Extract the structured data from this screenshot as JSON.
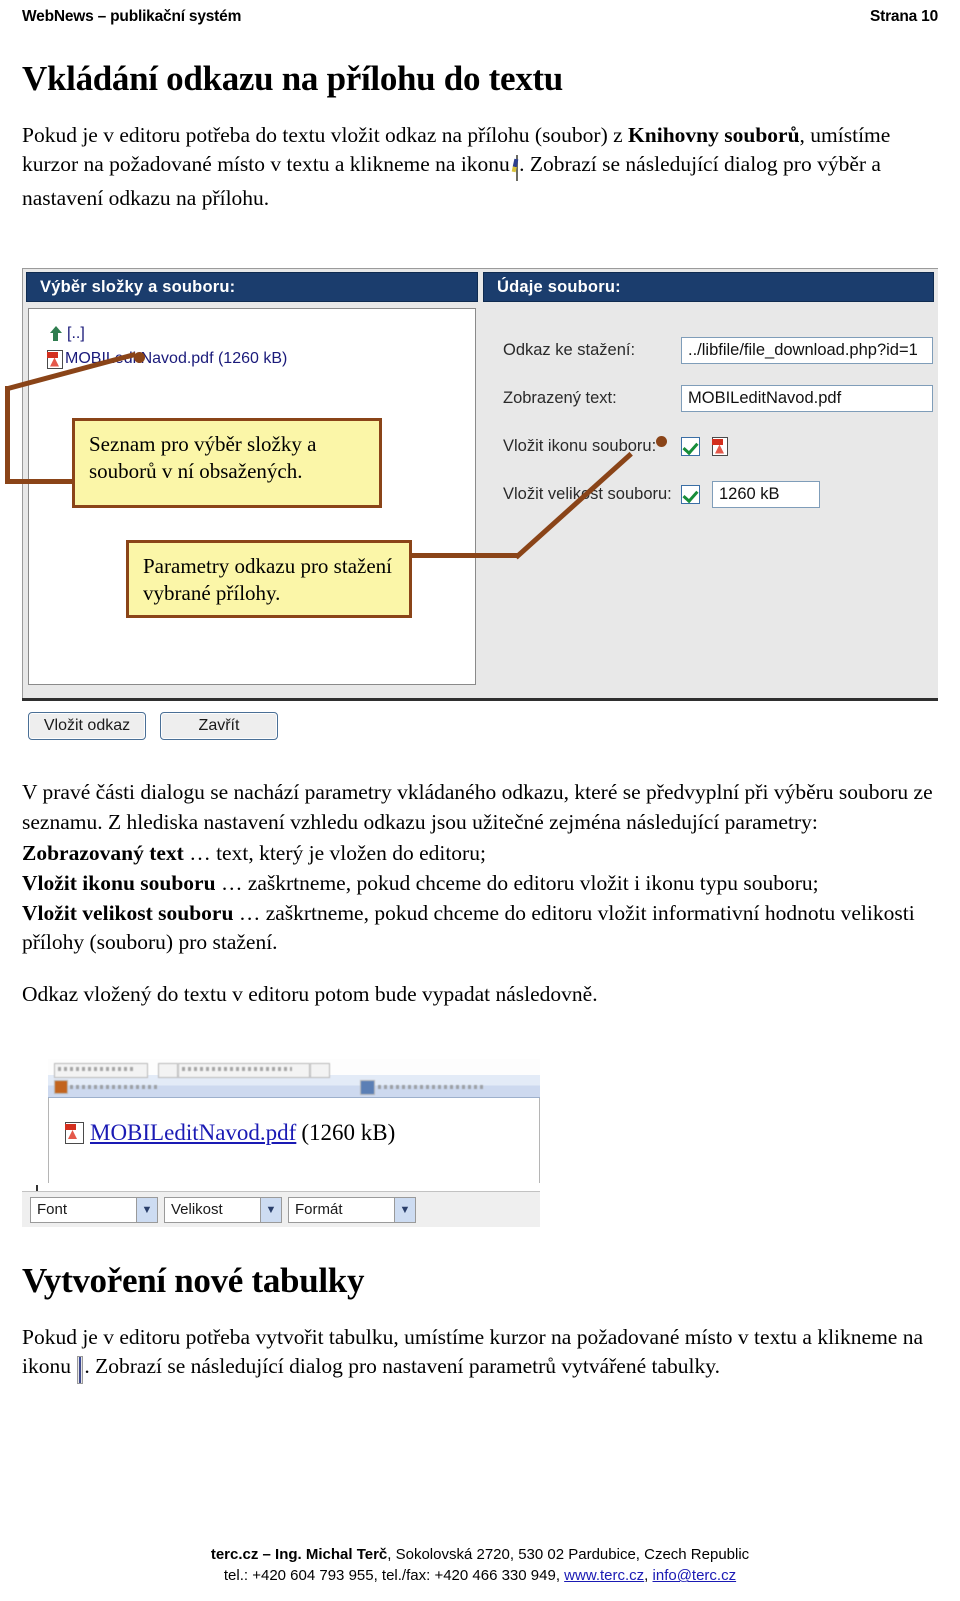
{
  "header": {
    "left": "WebNews – publikační systém",
    "right": "Strana 10"
  },
  "section1": {
    "title": "Vkládání odkazu na přílohu do textu",
    "intro_1": "Pokud je v editoru potřeba do textu vložit odkaz na přílohu (soubor) z ",
    "intro_bold": "Knihovny souborů",
    "intro_2": ", umístíme kurzor na požadované místo v textu a klikneme na ikonu ",
    "intro_3": ". Zobrazí se následující dialog pro výběr a nastavení odkazu na přílohu.",
    "attach_icon": "attachment-library-icon"
  },
  "dialog": {
    "left_panel": {
      "title": "Výběr složky a souboru:",
      "items": [
        {
          "icon": "folder-up-icon",
          "label": "[..]"
        },
        {
          "icon": "pdf-file-icon",
          "label": "MOBILeditNavod.pdf (1260 kB)"
        }
      ]
    },
    "right_panel": {
      "title": "Údaje souboru:",
      "fields": [
        {
          "label": "Odkaz ke stažení:",
          "value": "../libfile/file_download.php?id=1"
        },
        {
          "label": "Zobrazený text:",
          "value": "MOBILeditNavod.pdf"
        }
      ],
      "insert_icon": {
        "label": "Vložit ikonu souboru:",
        "checked": true,
        "icon": "pdf-file-icon"
      },
      "insert_size": {
        "label": "Vložit velikost souboru:",
        "checked": true,
        "value": "1260 kB"
      }
    },
    "buttons": {
      "insert": "Vložit odkaz",
      "close": "Zavřít"
    },
    "header_bg": "#1b3d6d"
  },
  "callouts": {
    "list": "Seznam pro výběr složky a souborů v ní obsažených.",
    "params": "Parametry odkazu pro stažení vybrané přílohy.",
    "color_fill": "#fbf6a8",
    "color_border": "#8a4418"
  },
  "section1_body": {
    "p1": "V pravé části dialogu se nachází parametry vkládaného odkazu, které se předvyplní při výběru souboru ze seznamu. Z hlediska nastavení vzhledu odkazu jsou užitečné zejména následující parametry:",
    "items": [
      {
        "term": "Zobrazovaný text",
        "desc": " … text, který je vložen do editoru;"
      },
      {
        "term": "Vložit ikonu souboru",
        "desc": " … zaškrtneme, pokud chceme do editoru vložit i ikonu typu souboru;"
      },
      {
        "term": "Vložit velikost souboru",
        "desc": " … zaškrtneme, pokud chceme do editoru vložit informativní hodnotu velikosti přílohy (souboru) pro stažení."
      }
    ],
    "p2": "Odkaz vložený do textu v editoru potom bude vypadat následovně."
  },
  "editor_preview": {
    "link_text": "MOBILeditNavod.pdf",
    "size_text": "(1260 kB)",
    "file_icon": "pdf-file-icon",
    "combos": [
      {
        "label": "Font"
      },
      {
        "label": "Velikost"
      },
      {
        "label": "Formát"
      }
    ]
  },
  "section2": {
    "title": "Vytvoření nové tabulky",
    "intro_1": "Pokud je v editoru potřeba vytvořit tabulku, umístíme kurzor na požadované místo v textu a klikneme na ikonu ",
    "intro_2": ". Zobrazí se následující dialog pro nastavení parametrů vytvářené tabulky.",
    "table_icon": "insert-table-icon"
  },
  "footer": {
    "line1_bold": "terc.cz – Ing. Michal Terč",
    "line1_rest": ", Sokolovská 2720, 530 02 Pardubice, Czech Republic",
    "line2_a": "tel.: +420 604 793 955, tel./fax: +420 466 330 949, ",
    "line2_link1": "www.terc.cz",
    "line2_sep": ", ",
    "line2_link2": "info@terc.cz"
  }
}
